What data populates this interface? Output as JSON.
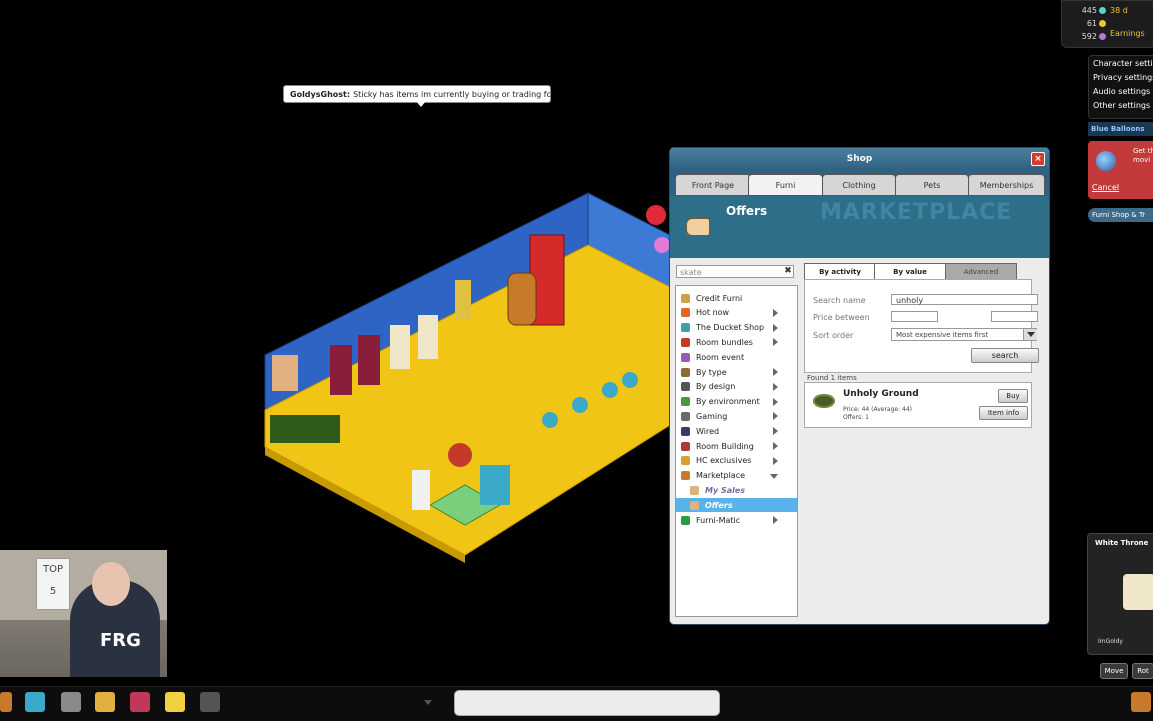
{
  "chat": {
    "user": "GoldysGhost:",
    "message": "Sticky has items im currently buying or trading for :)"
  },
  "shop": {
    "title": "Shop",
    "close": "×",
    "tabs": [
      "Front Page",
      "Furni",
      "Clothing",
      "Pets",
      "Memberships"
    ],
    "active_tab": "Furni",
    "header_title": "Offers",
    "header_bg_text": "MARKETPLACE",
    "search_placeholder": "skate",
    "search_clear": "✖",
    "categories": [
      {
        "label": "Credit Furni",
        "icon": "coin-icon",
        "color": "#c9a24a",
        "arrow": ""
      },
      {
        "label": "Hot now",
        "icon": "flame-icon",
        "color": "#e0662c",
        "arrow": "right"
      },
      {
        "label": "The Ducket Shop",
        "icon": "ducket-icon",
        "color": "#3fa0a3",
        "arrow": "right"
      },
      {
        "label": "Room bundles",
        "icon": "bundle-icon",
        "color": "#c0392b",
        "arrow": "right"
      },
      {
        "label": "Room event",
        "icon": "event-icon",
        "color": "#9b59b6",
        "arrow": ""
      },
      {
        "label": "By type",
        "icon": "type-icon",
        "color": "#8e6a3a",
        "arrow": "right"
      },
      {
        "label": "By design",
        "icon": "design-icon",
        "color": "#555555",
        "arrow": "right"
      },
      {
        "label": "By environment",
        "icon": "leaf-icon",
        "color": "#4a9a3a",
        "arrow": "right"
      },
      {
        "label": "Gaming",
        "icon": "gaming-icon",
        "color": "#6a6a6a",
        "arrow": "right"
      },
      {
        "label": "Wired",
        "icon": "wired-icon",
        "color": "#3a3a6a",
        "arrow": "right"
      },
      {
        "label": "Room Building",
        "icon": "hammer-icon",
        "color": "#aa3a3a",
        "arrow": "right"
      },
      {
        "label": "HC exclusives",
        "icon": "hc-icon",
        "color": "#d4a030",
        "arrow": "right"
      },
      {
        "label": "Marketplace",
        "icon": "marketplace-icon",
        "color": "#c77a2a",
        "arrow": "down"
      },
      {
        "label": "My Sales",
        "icon": "hand-icon",
        "color": "#e0b080",
        "arrow": "",
        "sub": true
      },
      {
        "label": "Offers",
        "icon": "hand-icon",
        "color": "#e0b080",
        "arrow": "",
        "sub": true,
        "selected": true
      },
      {
        "label": "Furni-Matic",
        "icon": "recycle-icon",
        "color": "#2a9a4a",
        "arrow": "right"
      }
    ],
    "filter_tabs": [
      "By activity",
      "By value",
      "Advanced"
    ],
    "filter": {
      "search_name_label": "Search name",
      "search_name_value": "unholy",
      "price_label": "Price between",
      "price_min": "",
      "price_max": "",
      "sort_label": "Sort order",
      "sort_value": "Most expensive items first",
      "search_button": "search"
    },
    "found_label": "Found 1 items",
    "result": {
      "name": "Unholy Ground",
      "price_line": "Price: 44 (Average: 44)",
      "offers_line": "Offers: 1",
      "buy_button": "Buy",
      "info_button": "Item info"
    }
  },
  "hud": {
    "diamonds": "445",
    "credits": "61",
    "duckets": "592",
    "days": "38 d",
    "earnings": "Earnings",
    "diamond_color": "#5fd2c8",
    "credit_color": "#f0c23a",
    "ducket_color": "#b07ad0"
  },
  "settings_menu": [
    "Character settings",
    "Privacy settings",
    "Audio settings",
    "Other settings"
  ],
  "blue_balloons": "Blue Balloons",
  "promo": {
    "text": "Get th movi",
    "cancel": "Cancel"
  },
  "marketplace_banner": "Furni Shop & Tr",
  "infocard": {
    "title": "White Throne",
    "owner": "ImGoldy",
    "move": "Move",
    "rotate": "Rot"
  },
  "webcam": {
    "sign_top": "TOP",
    "sign_bottom": "5",
    "shirt_logo": "FRG"
  }
}
